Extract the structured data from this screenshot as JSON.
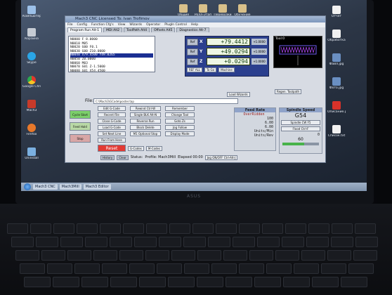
{
  "desktop": {
    "left_icons": [
      {
        "label": "Компьютер",
        "icon": "computer-icon"
      },
      {
        "label": "Корзина",
        "icon": "trash-icon"
      },
      {
        "label": "Skype",
        "icon": "skype-icon"
      },
      {
        "label": "Google Chrome",
        "icon": "chrome-icon"
      },
      {
        "label": "Mach3",
        "icon": "mach3-icon"
      },
      {
        "label": "Firefox",
        "icon": "firefox-icon"
      },
      {
        "label": "Uninstall",
        "icon": "app-icon"
      }
    ],
    "top_icons": [
      {
        "label": "Общие",
        "icon": "folder-icon"
      },
      {
        "label": "Ролл-Этап",
        "icon": "folder-icon"
      },
      {
        "label": "Перевозки",
        "icon": "folder-icon"
      },
      {
        "label": "Обучение",
        "icon": "folder-icon"
      }
    ],
    "right_icons": [
      {
        "label": "Отчет",
        "icon": "doc-icon"
      },
      {
        "label": "Обработка",
        "icon": "doc-icon"
      },
      {
        "label": "Файл.jpg",
        "icon": "image-icon"
      },
      {
        "label": "Фото.jpg",
        "icon": "image-icon"
      },
      {
        "label": "Описание.pdf",
        "icon": "pdf-icon"
      },
      {
        "label": "Список.txt",
        "icon": "doc-icon"
      }
    ]
  },
  "window": {
    "title": "Mach3 CNC  Licensed To: Ivan Trofimov",
    "menu": [
      "File",
      "Config",
      "Function Cfg's",
      "View",
      "Wizards",
      "Operator",
      "PlugIn Control",
      "Help"
    ],
    "tabs": [
      "Program Run Alt-1",
      "MDI Alt2",
      "ToolPath Alt4",
      "Offsets Alt5",
      "Diagnostics Alt-7"
    ],
    "active_tab": 0
  },
  "gcode": {
    "lines": [
      "N0000 F 8.0000",
      "N0010 M05",
      "N0020 G00 F0.1",
      "N0030 G00 Z10.0000",
      "N0040 X79.4500 Y49.0265",
      "N0050 Z0.0000",
      "N0060 M03",
      "N0070 G01 Z-1.5000",
      "N0080 G01 X54.4500",
      "N0090 G01 Y40.0000"
    ],
    "current_index": 4
  },
  "dro": {
    "x": "+79.4412",
    "y": "+49.0294",
    "z": "+0.0294",
    "scale": "+1.0000",
    "ref_label": "REF ALL"
  },
  "tool_display": {
    "title": "Tool:0"
  },
  "file": {
    "label": "File:",
    "path": "C:\\Mach3\\GCode\\poster.tap"
  },
  "buttons": {
    "cycle_start": "Cycle Start",
    "feed_hold": "Feed Hold",
    "stop": "Stop",
    "reset": "Reset",
    "edit_gcode": "Edit G-Code",
    "recent_file": "Recent File",
    "close_gcode": "Close G-Code",
    "load_gcode": "Load G-Code",
    "set_next_line": "Set Next Line",
    "run_from_here": "Run From Here",
    "rewind": "Rewind Ctrl-W",
    "single_blk": "Single BLK Alt-N",
    "reverse_run": "Reverse Run",
    "block_delete": "Block Delete",
    "m1_optional": "M1 Optional Stop",
    "load_wizards": "Load Wizards",
    "regen_toolpath": "Regen. Toolpath",
    "display_mode": "Display Mode",
    "jog_follow": "Jog Follow",
    "tool_change": "Remember",
    "change_tool": "Change Tool",
    "goto_zero": "Goto Zs",
    "to_go": "To Go",
    "machine": "Machine",
    "g_codes": "G-Codes",
    "m_codes": "M-Codes",
    "history": "History",
    "clear": "Clear",
    "spindle_cw": "Spindle CW F5",
    "flood": "Flood Ctrl-F"
  },
  "feed": {
    "title": "Feed Rate",
    "overridden": "OverRidden",
    "fro_pct": "100",
    "fro_value": "6.00",
    "feedrate_value": "6.00",
    "units_min": "Units/Min",
    "units_rev": "Units/Rev"
  },
  "spindle": {
    "title": "Spindle Speed",
    "tool_number": "G54",
    "sro_pct": "60",
    "rpm_value": "0",
    "sro_label": "Spindle CW F5"
  },
  "status": {
    "label": "Status:",
    "text": "Profile: Mach3Mill",
    "elapsed": "Elapsed 00:00",
    "jog_label": "Jog ON/OFF Ctrl-Alt-J"
  },
  "taskbar": {
    "items": [
      "Mach3 CNC",
      "Mach3Mill",
      "Mach3 Editor"
    ]
  },
  "brand": {
    "text": "ASUS"
  }
}
